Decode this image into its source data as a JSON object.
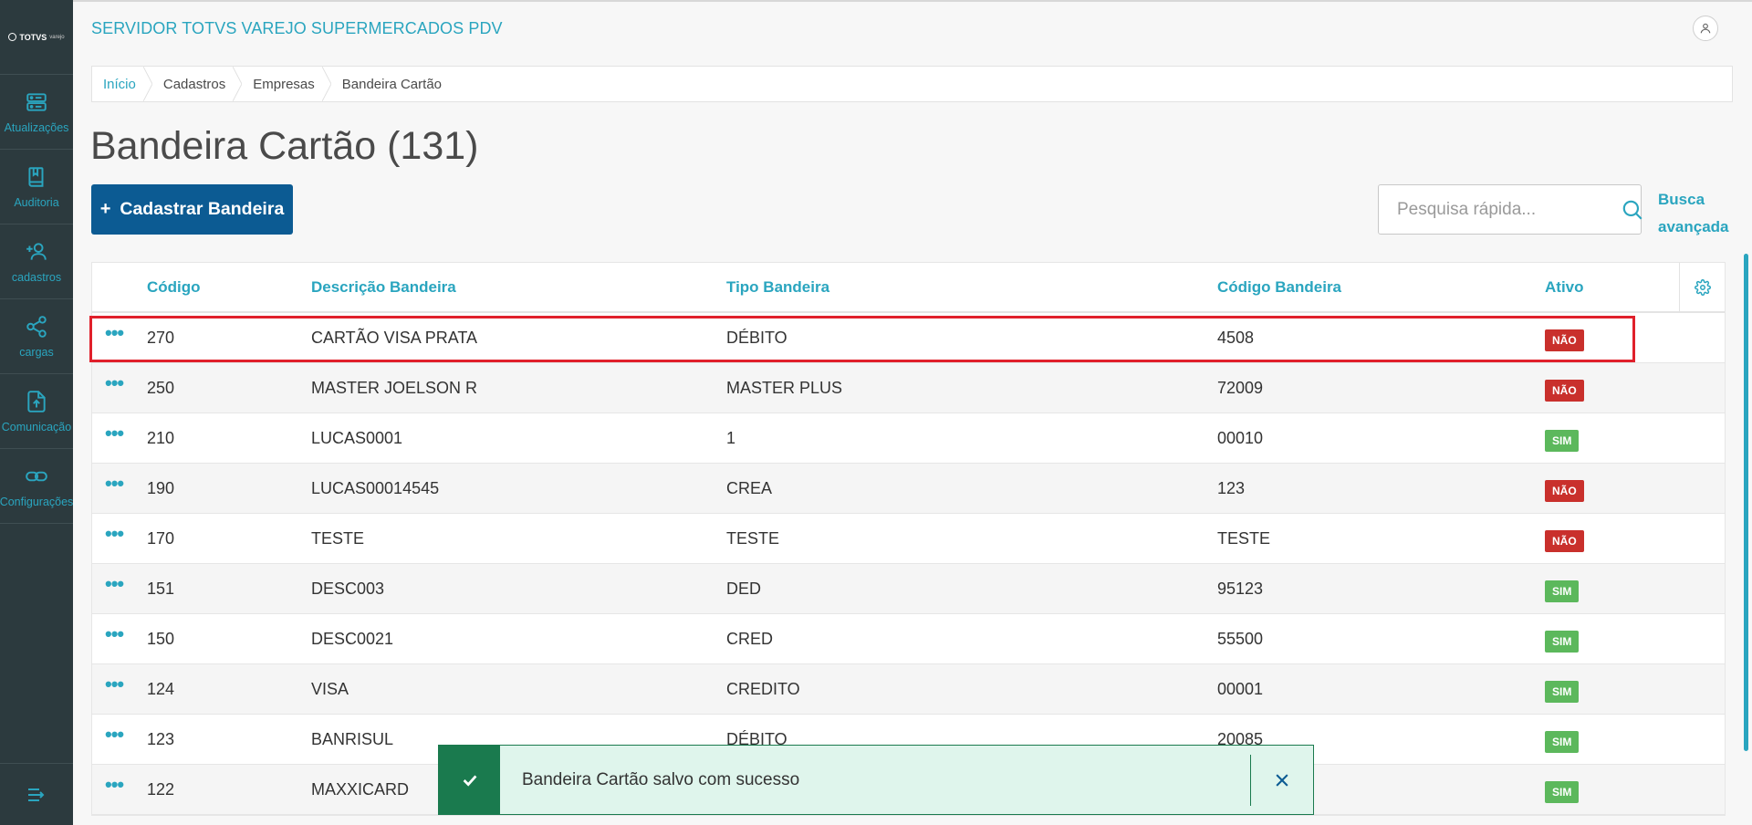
{
  "app": {
    "title": "SERVIDOR TOTVS VAREJO SUPERMERCADOS PDV",
    "logo_text": "TOTVS",
    "logo_sub": "varejo"
  },
  "sidebar": {
    "items": [
      {
        "label": "Atualizações",
        "icon": "server-icon"
      },
      {
        "label": "Auditoria",
        "icon": "book-icon"
      },
      {
        "label": "cadastros",
        "icon": "add-user-icon"
      },
      {
        "label": "cargas",
        "icon": "share-icon"
      },
      {
        "label": "Comunicação",
        "icon": "file-upload-icon"
      },
      {
        "label": "Configurações",
        "icon": "link-icon"
      }
    ]
  },
  "breadcrumb": [
    "Início",
    "Cadastros",
    "Empresas",
    "Bandeira Cartão"
  ],
  "page": {
    "title": "Bandeira Cartão (131)"
  },
  "actions": {
    "add_label": "Cadastrar Bandeira",
    "search_placeholder": "Pesquisa rápida...",
    "advanced_search_line1": "Busca",
    "advanced_search_line2": "avançada"
  },
  "table": {
    "columns": [
      "Código",
      "Descrição Bandeira",
      "Tipo Bandeira",
      "Código Bandeira",
      "Ativo"
    ],
    "rows": [
      {
        "codigo": "270",
        "descricao": "CARTÃO VISA PRATA",
        "tipo": "DÉBITO",
        "codigo_bandeira": "4508",
        "ativo": "NÃO"
      },
      {
        "codigo": "250",
        "descricao": "MASTER JOELSON R",
        "tipo": "MASTER PLUS",
        "codigo_bandeira": "72009",
        "ativo": "NÃO"
      },
      {
        "codigo": "210",
        "descricao": "LUCAS0001",
        "tipo": "1",
        "codigo_bandeira": "00010",
        "ativo": "SIM"
      },
      {
        "codigo": "190",
        "descricao": "LUCAS00014545",
        "tipo": "CREA",
        "codigo_bandeira": "123",
        "ativo": "NÃO"
      },
      {
        "codigo": "170",
        "descricao": "TESTE",
        "tipo": "TESTE",
        "codigo_bandeira": "TESTE",
        "ativo": "NÃO"
      },
      {
        "codigo": "151",
        "descricao": "DESC003",
        "tipo": "DED",
        "codigo_bandeira": "95123",
        "ativo": "SIM"
      },
      {
        "codigo": "150",
        "descricao": "DESC0021",
        "tipo": "CRED",
        "codigo_bandeira": "55500",
        "ativo": "SIM"
      },
      {
        "codigo": "124",
        "descricao": "VISA",
        "tipo": "CREDITO",
        "codigo_bandeira": "00001",
        "ativo": "SIM"
      },
      {
        "codigo": "123",
        "descricao": "BANRISUL",
        "tipo": "DÉBITO",
        "codigo_bandeira": "20085",
        "ativo": "SIM"
      },
      {
        "codigo": "122",
        "descricao": "MAXXICARD",
        "tipo": "",
        "codigo_bandeira": "",
        "ativo": "SIM"
      }
    ]
  },
  "toast": {
    "message": "Bandeira Cartão salvo com sucesso"
  },
  "colors": {
    "accent": "#2aa5bf",
    "primary_button": "#0c5b93",
    "sidebar": "#2c3a3e",
    "badge_no": "#c9302c",
    "badge_yes": "#5cb85c",
    "toast_success": "#1a7a4e"
  }
}
